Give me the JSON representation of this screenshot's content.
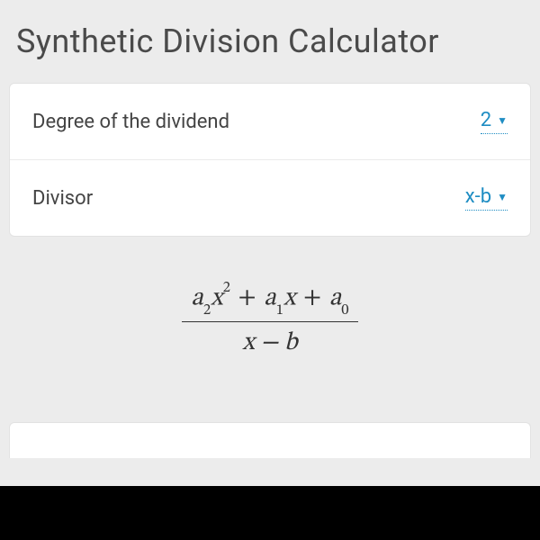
{
  "header": {
    "title": "Synthetic Division Calculator"
  },
  "fields": {
    "degree": {
      "label": "Degree of the dividend",
      "value": "2"
    },
    "divisor": {
      "label": "Divisor",
      "value": "x-b"
    }
  },
  "formula": {
    "numerator_terms": [
      {
        "coef": "a",
        "coef_sub": "2",
        "var": "x",
        "var_sup": "2"
      },
      {
        "coef": "a",
        "coef_sub": "1",
        "var": "x",
        "var_sup": ""
      },
      {
        "coef": "a",
        "coef_sub": "0",
        "var": "",
        "var_sup": ""
      }
    ],
    "denominator": "x − b"
  }
}
